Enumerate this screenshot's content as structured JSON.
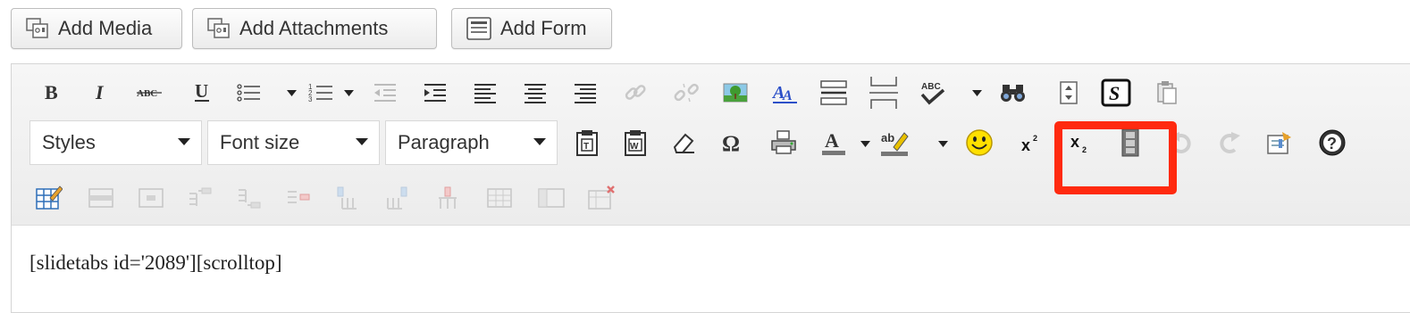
{
  "media_buttons": {
    "add_media": "Add Media",
    "add_attachments": "Add Attachments",
    "add_form": "Add Form"
  },
  "toolbar": {
    "row1": [
      "bold-icon",
      "italic-icon",
      "strikethrough-icon",
      "underline-icon",
      "bullet-list-icon",
      "numbered-list-icon",
      "outdent-icon",
      "indent-icon",
      "align-left-icon",
      "align-center-icon",
      "align-right-icon",
      "link-icon",
      "unlink-icon",
      "image-icon",
      "anchor-icon",
      "horizontal-rule-icon",
      "page-break-icon",
      "spellcheck-icon",
      "find-icon",
      "fullscreen-icon",
      "slidetabs-icon",
      "paste-icon"
    ],
    "styles_select": "Styles",
    "font_size_select": "Font size",
    "format_select": "Paragraph",
    "row2": [
      "paste-text-icon",
      "paste-word-icon",
      "remove-format-icon",
      "special-character-icon",
      "print-icon",
      "text-color-icon",
      "background-color-icon",
      "emoticon-icon",
      "superscript-icon",
      "subscript-icon",
      "media-icon",
      "undo-icon",
      "redo-icon",
      "cleanup-icon",
      "help-icon"
    ],
    "row3": [
      "table-icon",
      "row-properties-icon",
      "cell-properties-icon",
      "insert-row-before-icon",
      "insert-row-after-icon",
      "delete-row-icon",
      "insert-column-before-icon",
      "insert-column-after-icon",
      "delete-column-icon",
      "split-cells-icon",
      "merge-cells-icon",
      "delete-table-icon"
    ],
    "slidetabs_label": "S",
    "spell_label": "ABC",
    "strike_label": "ABC",
    "text_color_label": "A",
    "bg_color_label": "ab",
    "font_size_icon_label": "A"
  },
  "editor": {
    "content": "[slidetabs id='2089'][scrolltop]"
  },
  "colors": {
    "highlight": "#ff2a0f",
    "toolbar_bg": "#f0f0f0"
  }
}
